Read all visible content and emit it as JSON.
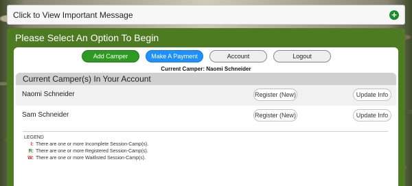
{
  "message_bar": {
    "label": "Click to View Important Message",
    "icon": "plus-circle-icon"
  },
  "panel": {
    "title": "Please Select An Option To Begin"
  },
  "actions": {
    "add_camper": "Add Camper",
    "make_payment": "Make A Payment",
    "account": "Account",
    "logout": "Logout"
  },
  "current_camper": "Current Camper: Naomi Schneider",
  "campers_section": {
    "title": "Current Camper(s) In Your Account",
    "campers": [
      {
        "name": "Naomi Schneider",
        "register": "Register (New)",
        "update": "Update Info"
      },
      {
        "name": "Sam Schneider",
        "register": "Register (New)",
        "update": "Update Info"
      }
    ]
  },
  "legend": {
    "title": "LEGEND",
    "items": [
      {
        "key": "I:",
        "text": "There are one or more Incomplete Session-Camp(s).",
        "color": "#c8331f"
      },
      {
        "key": "R:",
        "text": "There are one or more Registered Session-Camp(s).",
        "color": "#2a8a1e"
      },
      {
        "key": "W:",
        "text": "There are one or more Waitlisted Session-Camp(s).",
        "color": "#d42020"
      }
    ]
  },
  "colors": {
    "panel_green": "#4f7a24",
    "button_green": "#2e9a22",
    "button_blue": "#1e90ff"
  }
}
